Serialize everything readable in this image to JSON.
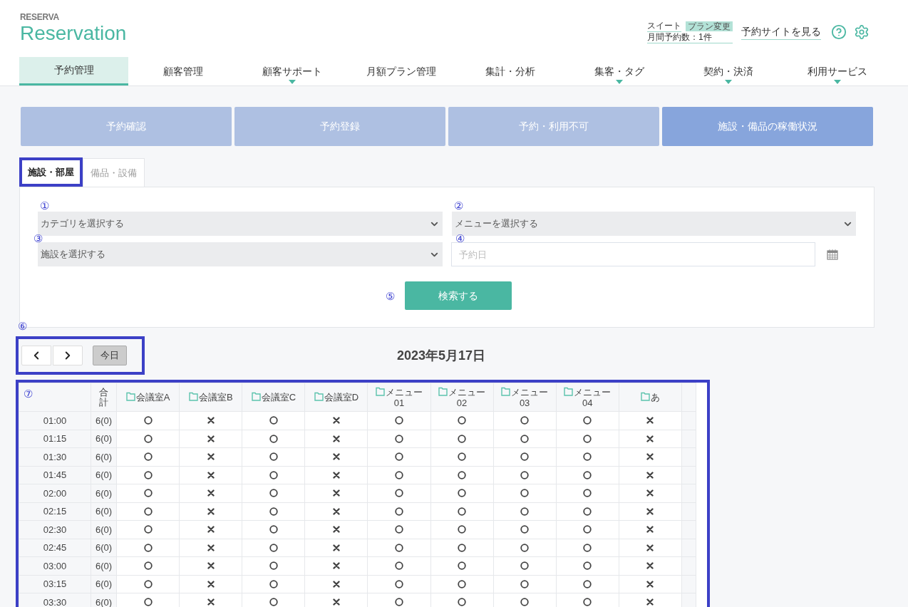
{
  "logo": {
    "brand": "RESERVA",
    "product": "Reservation"
  },
  "account": {
    "plan": "スイート",
    "plan_change": "プラン変更",
    "monthly": "月間予約数：1件",
    "site_link": "予約サイトを見る"
  },
  "nav": [
    {
      "label": "予約管理",
      "selected": true,
      "has_menu": false
    },
    {
      "label": "顧客管理",
      "selected": false,
      "has_menu": false
    },
    {
      "label": "顧客サポート",
      "selected": false,
      "has_menu": true
    },
    {
      "label": "月額プラン管理",
      "selected": false,
      "has_menu": false
    },
    {
      "label": "集計・分析",
      "selected": false,
      "has_menu": false
    },
    {
      "label": "集客・タグ",
      "selected": false,
      "has_menu": true
    },
    {
      "label": "契約・決済",
      "selected": false,
      "has_menu": true
    },
    {
      "label": "利用サービス",
      "selected": false,
      "has_menu": true
    }
  ],
  "subnav": [
    {
      "label": "予約確認",
      "selected": false
    },
    {
      "label": "予約登録",
      "selected": false
    },
    {
      "label": "予約・利用不可",
      "selected": false
    },
    {
      "label": "施設・備品の稼働状況",
      "selected": true
    }
  ],
  "tabs": [
    {
      "label": "施設・部屋",
      "selected": true,
      "highlighted": true
    },
    {
      "label": "備品・設備",
      "selected": false,
      "highlighted": false
    }
  ],
  "form": {
    "category": {
      "marker": "①",
      "value": "カテゴリを選択する"
    },
    "menu": {
      "marker": "②",
      "value": "メニューを選択する"
    },
    "facility": {
      "marker": "③",
      "value": "施設を選択する"
    },
    "date": {
      "marker": "④",
      "placeholder": "予約日"
    },
    "search": {
      "marker": "⑤",
      "label": "検索する"
    }
  },
  "date_nav": {
    "marker": "⑥",
    "today": "今日",
    "title": "2023年5月17日"
  },
  "table": {
    "marker": "⑦",
    "total_header": "合計",
    "columns": [
      "会議室A",
      "会議室B",
      "会議室C",
      "会議室D",
      "メニュー01",
      "メニュー02",
      "メニュー03",
      "メニュー04",
      "あ"
    ],
    "rows": [
      {
        "time": "01:00",
        "total": "6(0)",
        "slots": [
          true,
          false,
          true,
          false,
          true,
          true,
          true,
          true,
          false
        ]
      },
      {
        "time": "01:15",
        "total": "6(0)",
        "slots": [
          true,
          false,
          true,
          false,
          true,
          true,
          true,
          true,
          false
        ]
      },
      {
        "time": "01:30",
        "total": "6(0)",
        "slots": [
          true,
          false,
          true,
          false,
          true,
          true,
          true,
          true,
          false
        ]
      },
      {
        "time": "01:45",
        "total": "6(0)",
        "slots": [
          true,
          false,
          true,
          false,
          true,
          true,
          true,
          true,
          false
        ]
      },
      {
        "time": "02:00",
        "total": "6(0)",
        "slots": [
          true,
          false,
          true,
          false,
          true,
          true,
          true,
          true,
          false
        ]
      },
      {
        "time": "02:15",
        "total": "6(0)",
        "slots": [
          true,
          false,
          true,
          false,
          true,
          true,
          true,
          true,
          false
        ]
      },
      {
        "time": "02:30",
        "total": "6(0)",
        "slots": [
          true,
          false,
          true,
          false,
          true,
          true,
          true,
          true,
          false
        ]
      },
      {
        "time": "02:45",
        "total": "6(0)",
        "slots": [
          true,
          false,
          true,
          false,
          true,
          true,
          true,
          true,
          false
        ]
      },
      {
        "time": "03:00",
        "total": "6(0)",
        "slots": [
          true,
          false,
          true,
          false,
          true,
          true,
          true,
          true,
          false
        ]
      },
      {
        "time": "03:15",
        "total": "6(0)",
        "slots": [
          true,
          false,
          true,
          false,
          true,
          true,
          true,
          true,
          false
        ]
      },
      {
        "time": "03:30",
        "total": "6(0)",
        "slots": [
          true,
          false,
          true,
          false,
          true,
          true,
          true,
          true,
          false
        ]
      }
    ]
  }
}
